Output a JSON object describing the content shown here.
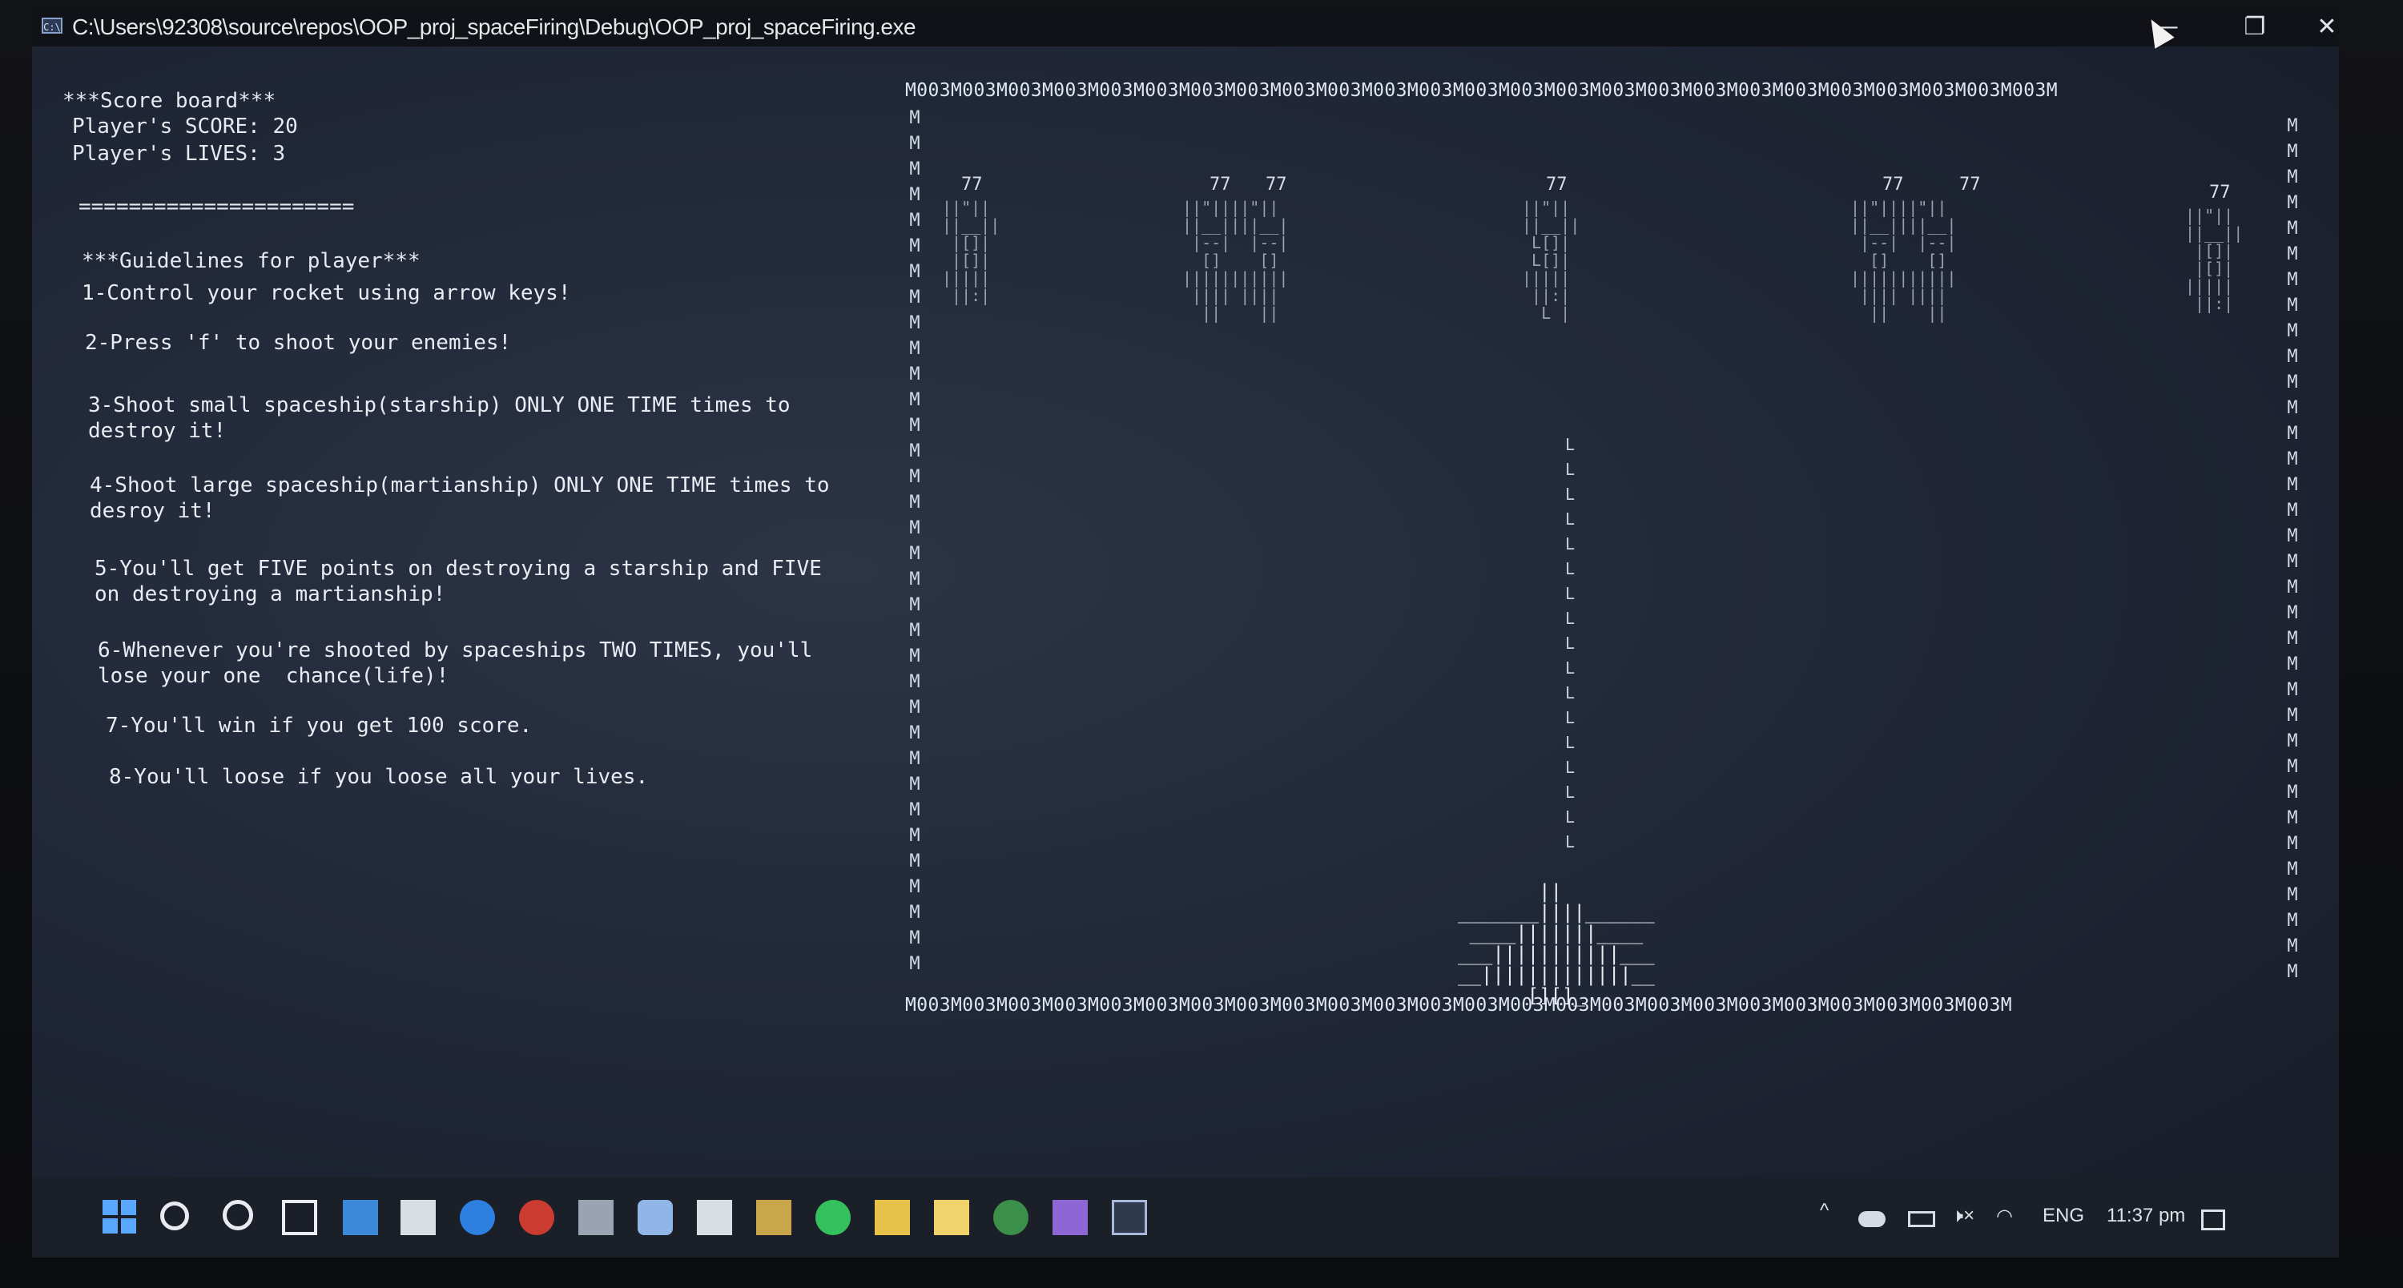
{
  "window": {
    "title": "C:\\Users\\92308\\source\\repos\\OOP_proj_spaceFiring\\Debug\\OOP_proj_spaceFiring.exe",
    "minimize_glyph": "—",
    "maximize_glyph": "❐",
    "close_glyph": "✕"
  },
  "scoreboard": {
    "heading": "***Score board***",
    "score_line": "Player's SCORE: 20",
    "lives_line": "Player's LIVES: 3",
    "separator": "======================"
  },
  "guidelines": {
    "heading": "***Guidelines for player***",
    "g1": "1-Control your rocket using arrow keys!",
    "g2": "2-Press 'f' to shoot your enemies!",
    "g3a": "3-Shoot small spaceship(starship) ONLY ONE TIME times to",
    "g3b": "destroy it!",
    "g4a": "4-Shoot large spaceship(martianship) ONLY ONE TIME times to",
    "g4b": "desroy it!",
    "g5a": "5-You'll get FIVE points on destroying a starship and FIVE",
    "g5b": "on destroying a martianship!",
    "g6a": "6-Whenever you're shooted by spaceships TWO TIMES, you'll",
    "g6b": "lose your one  chance(life)!",
    "g7": "7-You'll win if you get 100 score.",
    "g8": "8-You'll loose if you loose all your lives."
  },
  "game": {
    "border_top": "M003M003M003M003M003M003M003M003M003M003M003M003M003M003M003M003M003M003M003M003M003M003M003M003M003M",
    "border_bottom": "M003M003M003M003M003M003M003M003M003M003M003M003M003M003M003M003M003M003M003M003M003M003M003M003M",
    "wall_char": "M",
    "ship_label": "77",
    "laser_char": "L",
    "rocket_cockpit": "[][]"
  },
  "taskbar": {
    "language": "ENG",
    "time": "11:37 pm"
  }
}
